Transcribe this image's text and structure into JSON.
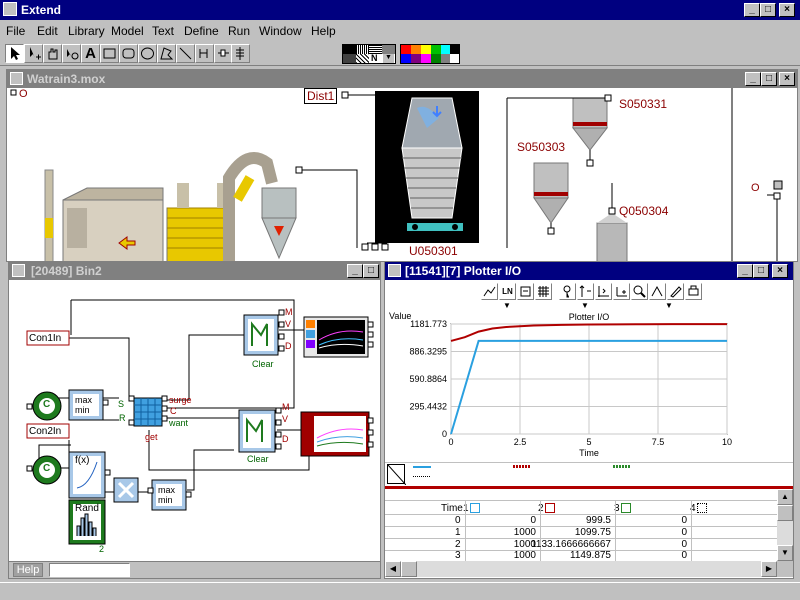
{
  "app": {
    "title": "Extend"
  },
  "menu": [
    "File",
    "Edit",
    "Library",
    "Model",
    "Text",
    "Define",
    "Run",
    "Window",
    "Help"
  ],
  "colors": {
    "titlebar": "#000080",
    "desktop": "#c0c0c0",
    "series1": "#2aa0e0",
    "series2": "#b00000",
    "series3": "#2a8a2a"
  },
  "pattern_box_label": "N",
  "model_window": {
    "title": "Watrain3.mox",
    "labels": {
      "dist": "Dist1",
      "u": "U050301",
      "s331": "S050331",
      "s303": "S050303",
      "q": "Q050304"
    }
  },
  "bin_window": {
    "title": "[20489]   Bin2",
    "labels": {
      "con1": "Con1In",
      "con2": "Con2In",
      "c1": "C",
      "c2": "C",
      "max1": "max",
      "min1": "min",
      "max2": "max",
      "min2": "min",
      "s": "S",
      "r": "R",
      "surge": "surge",
      "c_port": "C",
      "want": "want",
      "get": "get",
      "fx": "f(x)",
      "rand": "Rand",
      "two": "2",
      "clear1": "Clear",
      "clear2": "Clear",
      "m1": "M",
      "v1": "V",
      "d1": "D",
      "m2": "M",
      "v2": "V",
      "d2": "D",
      "help": "Help"
    }
  },
  "plotter_window": {
    "title": "[11541][7]  Plotter I/O",
    "tools": [
      "LN"
    ],
    "chart_data": {
      "type": "line",
      "title": "Plotter I/O",
      "ylabel": "Value",
      "xlabel": "Time",
      "x_ticks": [
        "0",
        "2.5",
        "5",
        "7.5",
        "10"
      ],
      "y_ticks": [
        "1181.773",
        "886.3295",
        "590.8864",
        "295.4432",
        "0"
      ],
      "xlim": [
        0,
        10
      ],
      "ylim": [
        0,
        1181.773
      ],
      "series": [
        {
          "color": "#2aa0e0",
          "x": [
            0,
            1,
            10
          ],
          "y": [
            0,
            1000,
            1000
          ]
        },
        {
          "color": "#b00000",
          "x": [
            0,
            0.5,
            1,
            1.5,
            2,
            3,
            4,
            5,
            6,
            7,
            8,
            9,
            10
          ],
          "y": [
            999.5,
            1040,
            1099.75,
            1133.17,
            1149.88,
            1165,
            1172,
            1176,
            1178,
            1179,
            1180,
            1180.5,
            1181
          ]
        }
      ]
    },
    "table": {
      "header": {
        "time": "Time",
        "c1": "1",
        "c2": "2",
        "c3": "3",
        "c4": "4"
      },
      "rows": [
        {
          "idx": "0",
          "a": "0",
          "b": "999.5",
          "c": "0"
        },
        {
          "idx": "1",
          "a": "1000",
          "b": "1099.75",
          "c": "0"
        },
        {
          "idx": "2",
          "a": "1000",
          "b": "1133.1666666667",
          "c": "0"
        },
        {
          "idx": "3",
          "a": "1000",
          "b": "1149.875",
          "c": "0"
        }
      ]
    }
  }
}
